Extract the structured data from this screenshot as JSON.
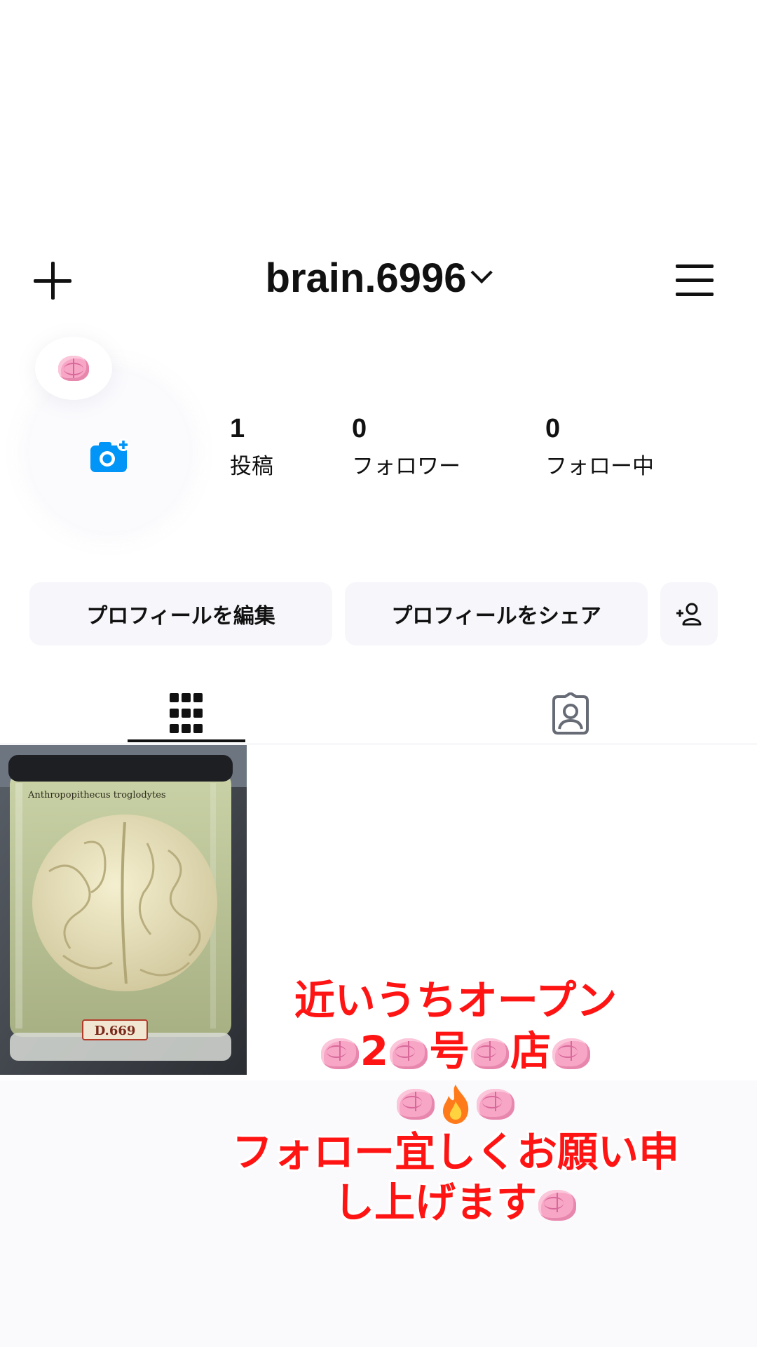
{
  "header": {
    "username": "brain.6996"
  },
  "profile": {
    "stats": [
      {
        "count": "1",
        "label": "投稿"
      },
      {
        "count": "0",
        "label": "フォロワー"
      },
      {
        "count": "0",
        "label": "フォロー中"
      }
    ]
  },
  "buttons": {
    "edit_profile": "プロフィールを編集",
    "share_profile": "プロフィールをシェア"
  },
  "post": {
    "jar_label": "Anthropopithecus troglodytes",
    "tag": "D.669"
  },
  "story_text": {
    "line1": "近いうちオープン",
    "line2_a": "2",
    "line2_b": "号",
    "line2_c": "店",
    "line4": "フォロー宜しくお願い申",
    "line5": "し上げます"
  },
  "colors": {
    "accent_blue": "#0095f6",
    "overlay_red": "#ff1414"
  }
}
